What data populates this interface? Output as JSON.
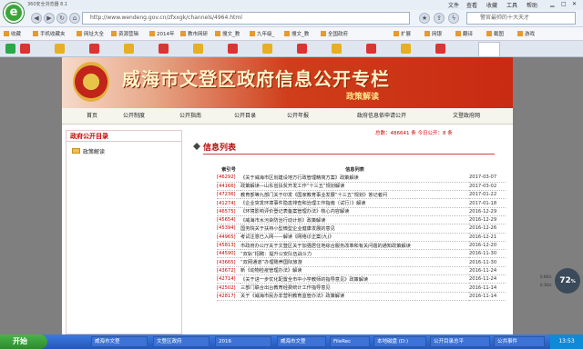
{
  "browser": {
    "title": "360安全浏览器 8.1",
    "menu": [
      "文件",
      "查看",
      "收藏",
      "工具",
      "帮助"
    ],
    "url": "http://www.wendeng.gov.cn/zfxxgk/channels/4964.html",
    "search_placeholder": "警官最帅的十大天才",
    "favorites": [
      "收藏",
      "手机收藏夹",
      "网址大全",
      "资源营辑",
      "2014年",
      "教市网研",
      "搜文_教",
      "九年级_",
      "搜文_教",
      "全国政府"
    ],
    "login": "登录管家",
    "tabs_right": [
      "扩展",
      "网银",
      "翻译",
      "截图",
      "游戏"
    ]
  },
  "site": {
    "title": "威海市文登区政府信息公开专栏",
    "subtitle": "政策解读",
    "nav": [
      "首页",
      "公开制度",
      "公开指南",
      "公开目录",
      "公开年报",
      "政府信息依申请公开",
      "文登政府网"
    ]
  },
  "sidebar": {
    "heading": "政府公开目录",
    "item": "政策解读"
  },
  "stats": {
    "total_label": "总数：",
    "total": "486641",
    "unit": "条",
    "today_label": "今日公开：",
    "today": "8",
    "today_unit": "条"
  },
  "list": {
    "title": "信息列表",
    "col_index": "索引号",
    "col_name": "信息列表",
    "rows": [
      {
        "num": "[46292]",
        "title": "《关于威海市区划建设地方行政管理精简方案》政策解读",
        "date": "2017-03-07"
      },
      {
        "num": "[44166]",
        "title": "政策解读—山东省扶贫开发工作“十三五”规划解读",
        "date": "2017-03-02"
      },
      {
        "num": "[47236]",
        "title": "教育部等九部门关于印发《国家教育事业发展“十三五”规划》答记者问",
        "date": "2017-01-22"
      },
      {
        "num": "[41274]",
        "title": "《企业突发环境事件隐患排查和治理工作指南（试行）》解读",
        "date": "2017-01-18"
      },
      {
        "num": "[46575]",
        "title": "《环境影响评价登记表备案管理办法》核心内容解读",
        "date": "2016-12-29"
      },
      {
        "num": "[45654]",
        "title": "《威海市水污染防治行动计划》政策解读",
        "date": "2016-12-29"
      },
      {
        "num": "[45394]",
        "title": "国务院关于扶持小型微型企业健康发展的意见",
        "date": "2016-12-26"
      },
      {
        "num": "[44965]",
        "title": "考试注意已入网——解读《网络诊正案(九)》",
        "date": "2016-12-21"
      },
      {
        "num": "[45813]",
        "title": "市政府办公厅关于文登区关于加强居住地综合服务改革和有关问题的通知政策解读",
        "date": "2016-12-20"
      },
      {
        "num": "[44590]",
        "title": "“双轨”招聘：提升公安队伍战斗力",
        "date": "2016-11-30"
      },
      {
        "num": "[43665]",
        "title": "“双网通道”办理赡养国际旅游",
        "date": "2016-11-30"
      },
      {
        "num": "[43672]",
        "title": "新《动物检疫管理办法》解读",
        "date": "2016-11-24"
      },
      {
        "num": "[42714]",
        "title": "《关于进一步优化配置全市中小学教师的指导意见》政策解读",
        "date": "2016-11-24"
      },
      {
        "num": "[42502]",
        "title": "三部门联合出台教育经费统计工作指导意见",
        "date": "2016-11-14"
      },
      {
        "num": "[42817]",
        "title": "关于《威海市民办非营利教育监管办法》政策解读",
        "date": "2016-11-14"
      }
    ]
  },
  "taskbar": {
    "start": "开始",
    "tasks": [
      "威海市文登",
      "文登区政府",
      "2016",
      "威海市文登",
      "FileRec",
      "本地磁盘 (D:)",
      "公开目录总平",
      "公共事件"
    ],
    "clock": "13:53"
  },
  "speed": {
    "value": "72",
    "unit": "%",
    "up": "0.6K/s",
    "down": "0.1K/s"
  }
}
